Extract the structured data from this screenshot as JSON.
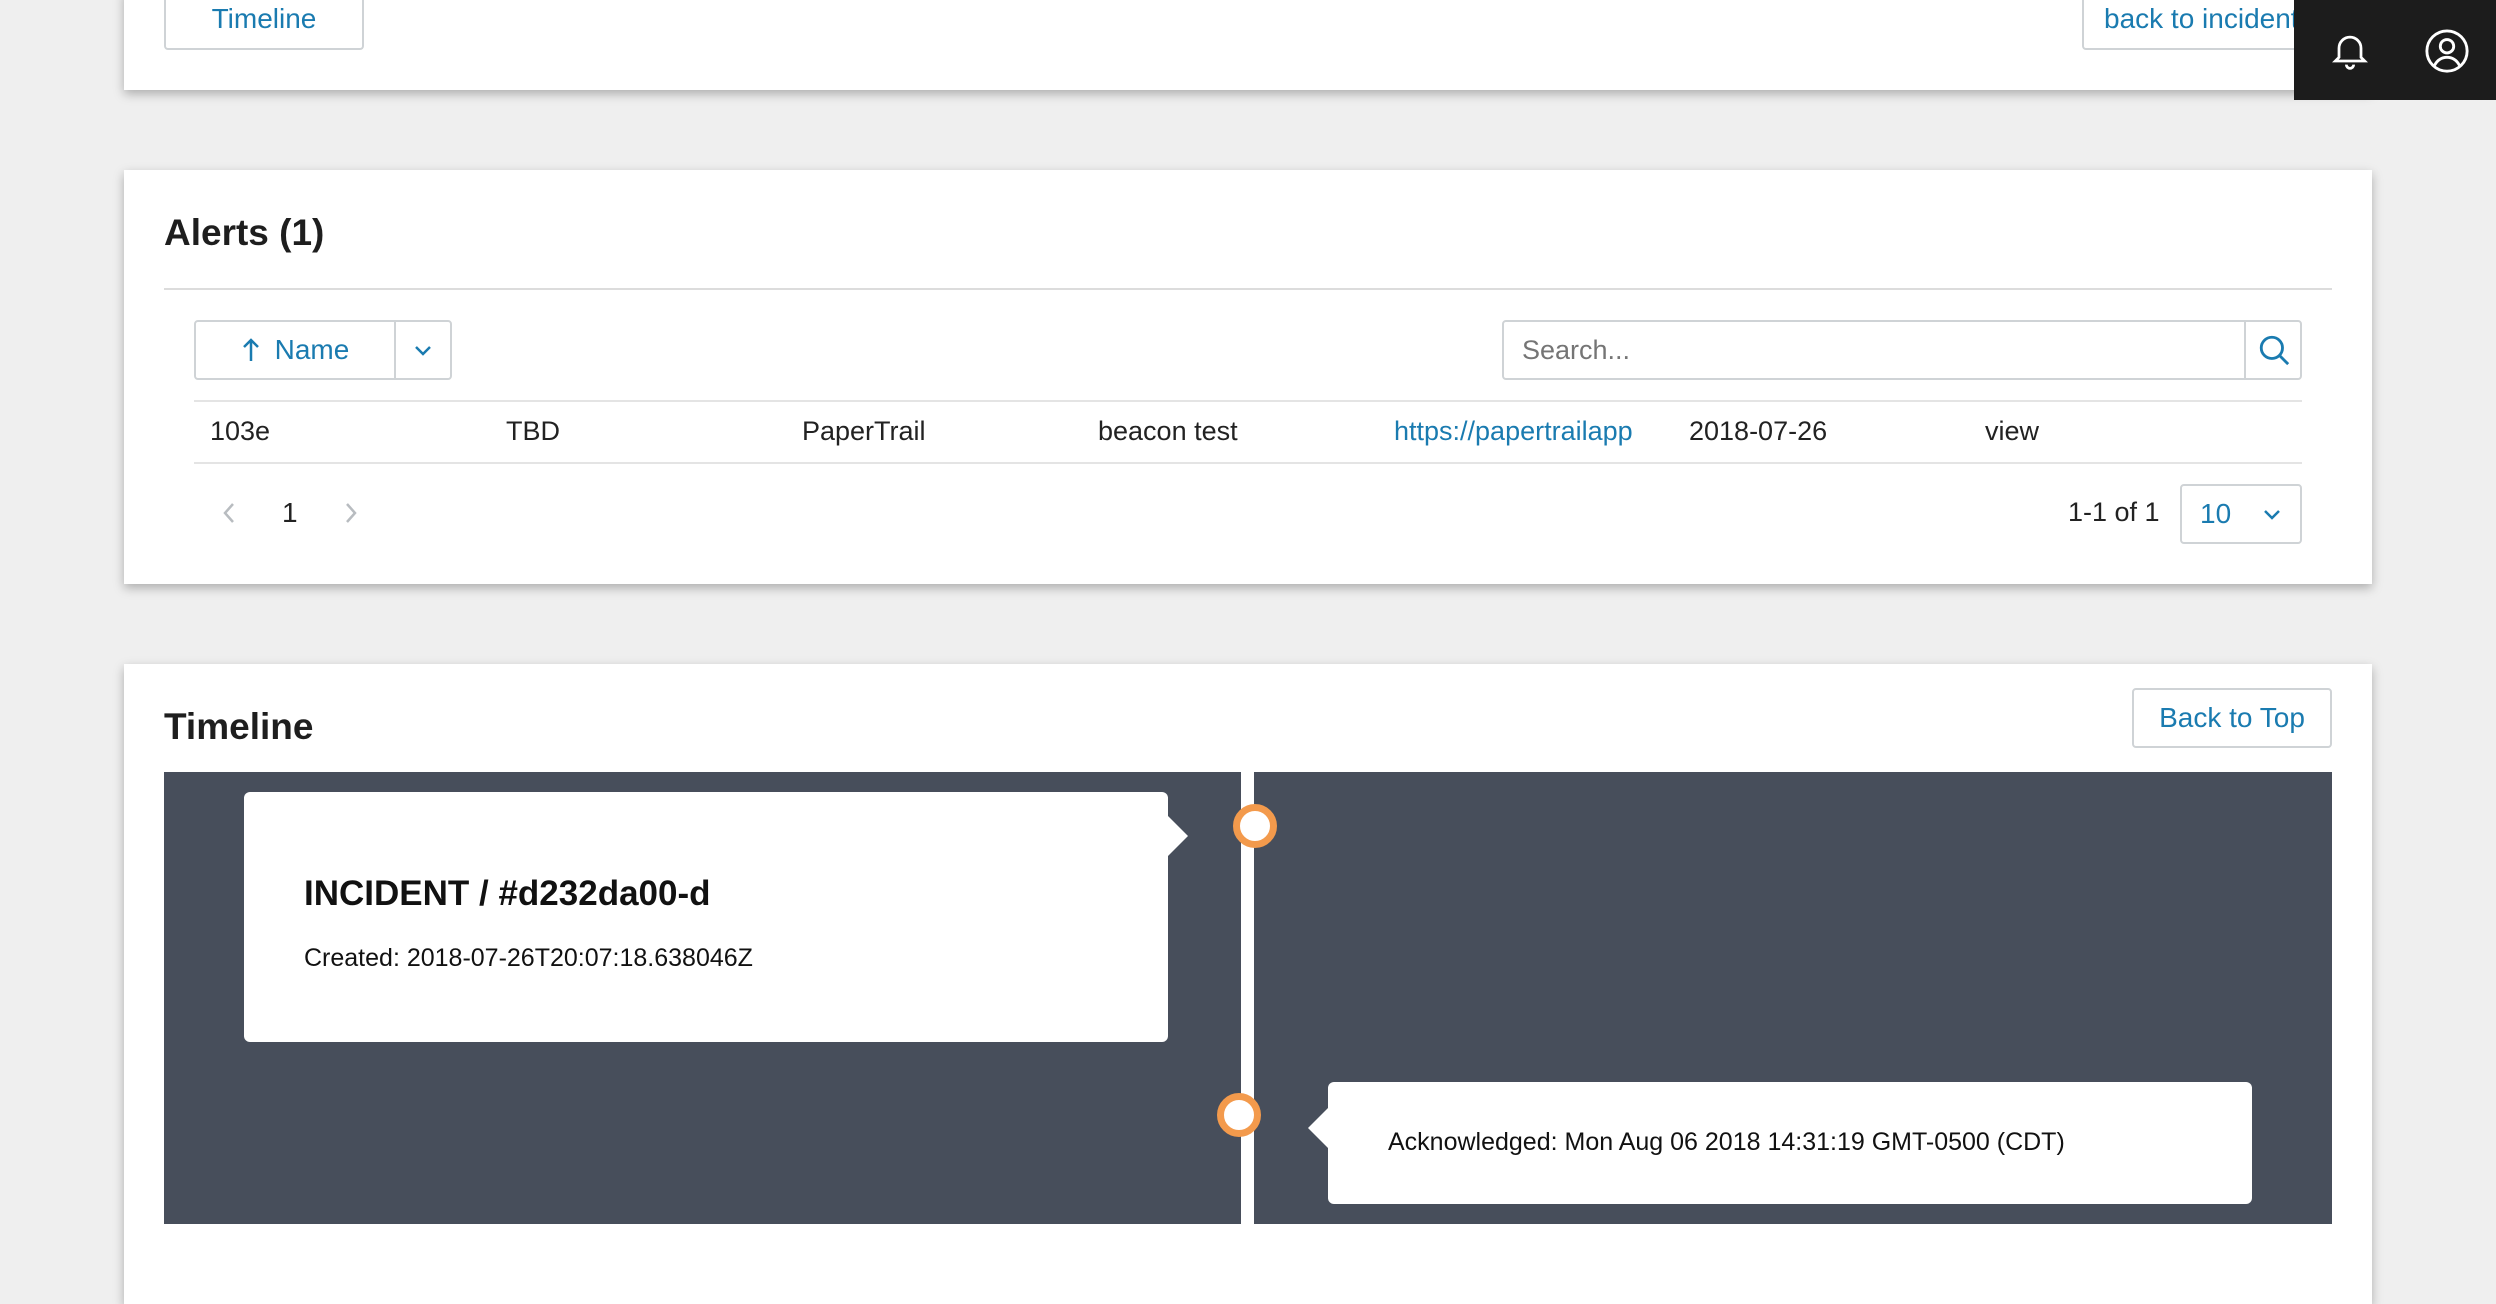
{
  "top_card": {
    "timeline_button": "Timeline",
    "back_to_incident_button": "back to incident"
  },
  "topbar": {
    "notifications_icon": "bell-icon",
    "profile_icon": "user-circle-icon"
  },
  "alerts": {
    "title": "Alerts (1)",
    "sort_label": "Name",
    "search_placeholder": "Search...",
    "rows": [
      [
        "103e",
        "TBD",
        "PaperTrail",
        "beacon test",
        "https://papertrailapp",
        "2018-07-26",
        "view"
      ]
    ],
    "pagination": {
      "current_page": "1",
      "range_text": "1-1 of 1",
      "page_size": "10"
    }
  },
  "timeline": {
    "title": "Timeline",
    "back_to_top": "Back to Top",
    "events": [
      {
        "title": "INCIDENT / #d232da00-d",
        "text": "Created: 2018-07-26T20:07:18.638046Z"
      },
      {
        "text": "Acknowledged: Mon Aug 06 2018 14:31:19 GMT-0500 (CDT)"
      }
    ]
  },
  "colors": {
    "accent": "#1a7bb0",
    "timeline_bg": "#474e5b",
    "timeline_node": "#f39a4c",
    "topbar_bg": "#1c1c1c"
  }
}
